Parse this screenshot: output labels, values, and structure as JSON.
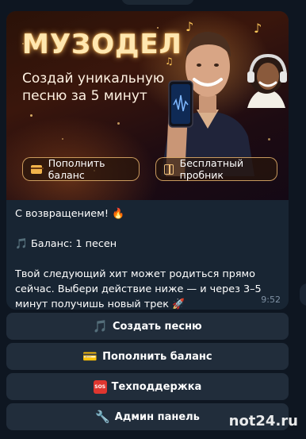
{
  "message": {
    "banner": {
      "brand": "МУЗОДЕЛ",
      "subtitle_line1": "Создай уникальную",
      "subtitle_line2": "песню за 5 минут",
      "buttons": [
        {
          "label": "Пополнить баланс",
          "icon": "credit-card-icon"
        },
        {
          "label": "Бесплатный пробник",
          "icon": "gift-icon"
        }
      ]
    },
    "lines": [
      "С возвращением! 🔥",
      "🎵 Баланс: 1 песен",
      "Твой следующий хит может родиться прямо сейчас. Выбери действие ниже — и через 3–5 минут получишь новый трек 🚀"
    ],
    "time": "9:52"
  },
  "keyboard": [
    {
      "emoji": "🎵",
      "label": "Создать песню"
    },
    {
      "emoji": "💳",
      "label": "Пополнить баланс"
    },
    {
      "emoji": "SOS",
      "label": "Техподдержка"
    },
    {
      "emoji": "🔧",
      "label": "Админ панель"
    }
  ],
  "watermark": "not24.ru",
  "colors": {
    "background": "#0e1621",
    "bubble": "#182533",
    "keyboard_button": "#212d3b",
    "accent": "#ffc85a"
  }
}
